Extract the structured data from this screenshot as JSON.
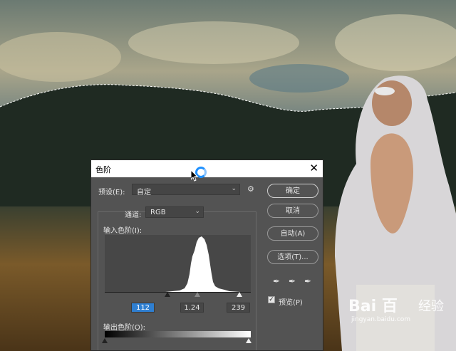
{
  "dialog": {
    "title": "色阶",
    "close_glyph": "✕",
    "preset_label": "预设(E):",
    "preset_value": "自定",
    "channel_label": "通道:",
    "channel_value": "RGB",
    "input_levels_label": "输入色阶(I):",
    "input_black": "112",
    "input_gamma": "1.24",
    "input_white": "239",
    "output_levels_label": "输出色阶(O):",
    "buttons": {
      "ok": "确定",
      "cancel": "取消",
      "auto": "自动(A)",
      "options": "选项(T)..."
    },
    "preview_label": "预览(P)",
    "preview_checked": true
  },
  "watermark": {
    "logo": "Bai 百",
    "text": "经验",
    "url": "jingyan.baidu.com"
  },
  "colors": {
    "dialog_bg": "#535353",
    "selection_highlight": "#2f7fd1",
    "spinner": "#1e90ff"
  }
}
